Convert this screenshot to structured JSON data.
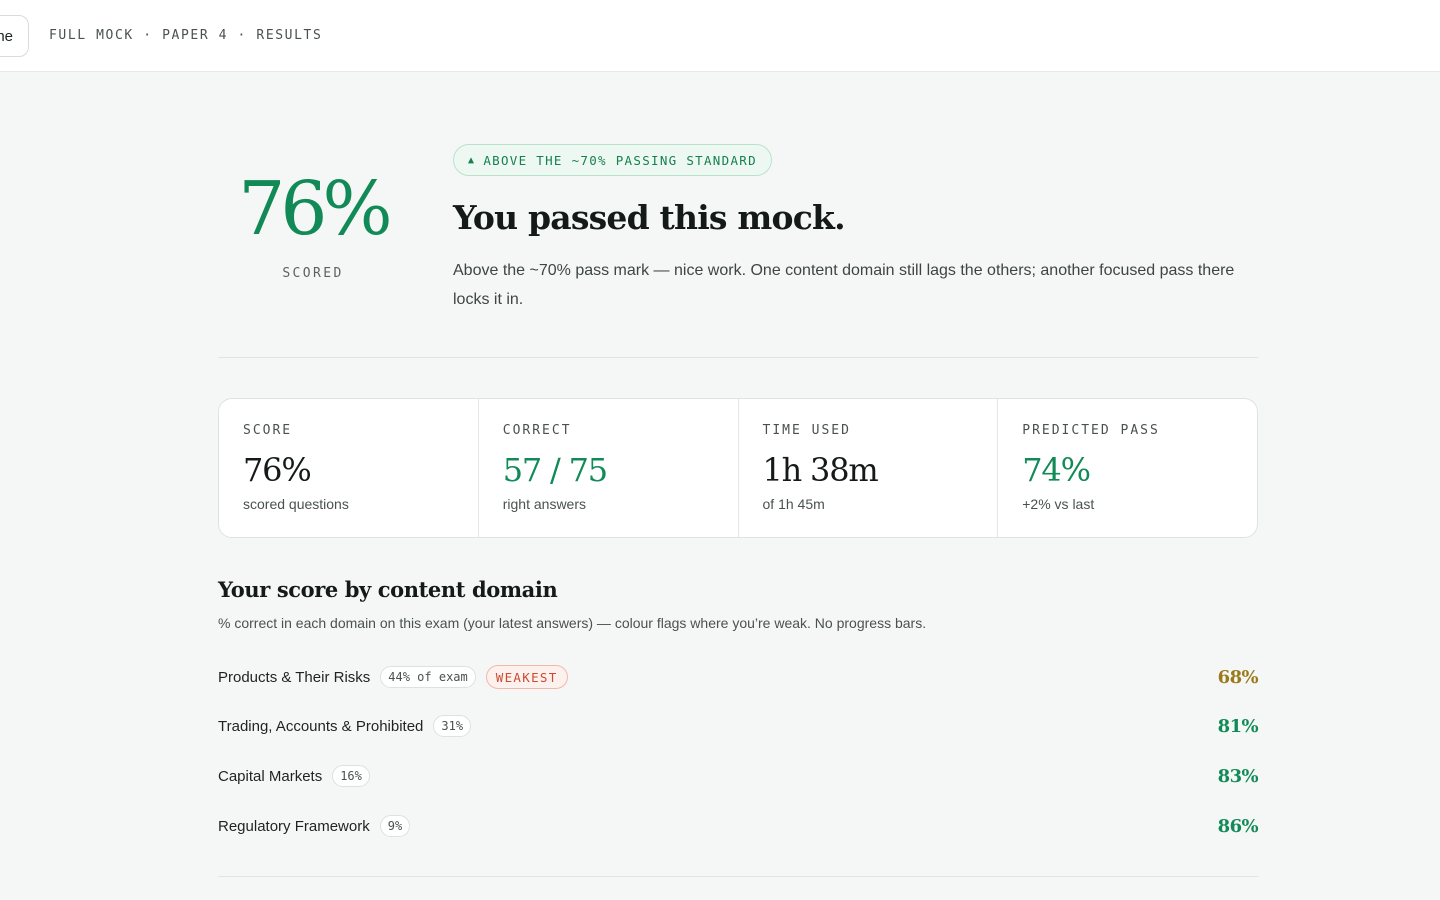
{
  "topbar": {
    "back_label": "Home",
    "back_visible": "he",
    "breadcrumb": "FULL MOCK · PAPER 4 · RESULTS"
  },
  "hero": {
    "score": "76%",
    "score_label": "SCORED",
    "badge_icon": "▲",
    "badge_text": "ABOVE THE ~70% PASSING STANDARD",
    "headline": "You passed this mock.",
    "summary": "Above the ~70% pass mark — nice work. One content domain still lags the others; another focused pass there locks it in."
  },
  "stats": [
    {
      "label": "SCORE",
      "value": "76%",
      "sub": "scored questions",
      "highlight": false
    },
    {
      "label": "CORRECT",
      "value": "57 / 75",
      "sub": "right answers",
      "highlight": true
    },
    {
      "label": "TIME USED",
      "value": "1h 38m",
      "sub": "of 1h 45m",
      "highlight": false
    },
    {
      "label": "PREDICTED PASS",
      "value": "74%",
      "sub": "+2% vs last",
      "highlight": true
    }
  ],
  "domains_section": {
    "title": "Your score by content domain",
    "description": "% correct in each domain on this exam (your latest answers) — colour flags where you’re weak. No progress bars.",
    "rows": [
      {
        "name": "Products & Their Risks",
        "weight": "44% of exam",
        "flag": "WEAKEST",
        "score": "68%"
      },
      {
        "name": "Trading, Accounts & Prohibited",
        "weight": "31%",
        "flag": "",
        "score": "81%"
      },
      {
        "name": "Capital Markets",
        "weight": "16%",
        "flag": "",
        "score": "83%"
      },
      {
        "name": "Regulatory Framework",
        "weight": "9%",
        "flag": "",
        "score": "86%"
      }
    ]
  },
  "colors": {
    "accent_green": "#128a57",
    "warn_amber": "#9a7a1c",
    "weak_red": "#c94b33",
    "background": "#f5f7f6"
  }
}
